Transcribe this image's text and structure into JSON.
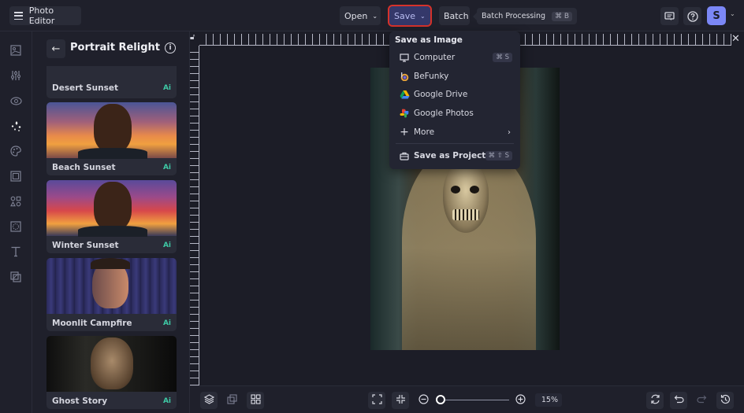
{
  "topbar": {
    "app_title": "Photo Editor",
    "open_label": "Open",
    "save_label": "Save",
    "batch_label": "Batch",
    "tooltip": {
      "label": "Batch Processing",
      "shortcut": "⌘ B"
    },
    "avatar_initial": "S"
  },
  "rail": {
    "items": [
      {
        "icon": "image-manager-icon"
      },
      {
        "icon": "adjustments-icon"
      },
      {
        "icon": "touch-up-icon"
      },
      {
        "icon": "effects-sparkle-icon",
        "active": true
      },
      {
        "icon": "artsy-palette-icon"
      },
      {
        "icon": "frames-icon"
      },
      {
        "icon": "graphics-shapes-icon"
      },
      {
        "icon": "overlays-icon"
      },
      {
        "icon": "text-icon"
      },
      {
        "icon": "textures-icon"
      }
    ]
  },
  "panel": {
    "title": "Portrait Relight",
    "presets": [
      {
        "name": "Desert Sunset",
        "badge": "Ai"
      },
      {
        "name": "Beach Sunset",
        "badge": "Ai"
      },
      {
        "name": "Winter Sunset",
        "badge": "Ai"
      },
      {
        "name": "Moonlit Campfire",
        "badge": "Ai"
      },
      {
        "name": "Ghost Story",
        "badge": "Ai"
      }
    ]
  },
  "save_menu": {
    "header": "Save as Image",
    "items": [
      {
        "label": "Computer",
        "icon": "monitor-icon",
        "shortcut": "⌘ S"
      },
      {
        "label": "BeFunky",
        "icon": "befunky-icon"
      },
      {
        "label": "Google Drive",
        "icon": "google-drive-icon"
      },
      {
        "label": "Google Photos",
        "icon": "google-photos-icon"
      },
      {
        "label": "More",
        "icon": "plus-icon"
      }
    ],
    "project": {
      "label": "Save as Project",
      "shortcut": "⌘ ⇧ S"
    }
  },
  "bottombar": {
    "zoom_value": "15%"
  },
  "colors": {
    "accent": "#7b87f6",
    "save_highlight": "#d6322b",
    "ai_badge": "#3ec9a5"
  }
}
